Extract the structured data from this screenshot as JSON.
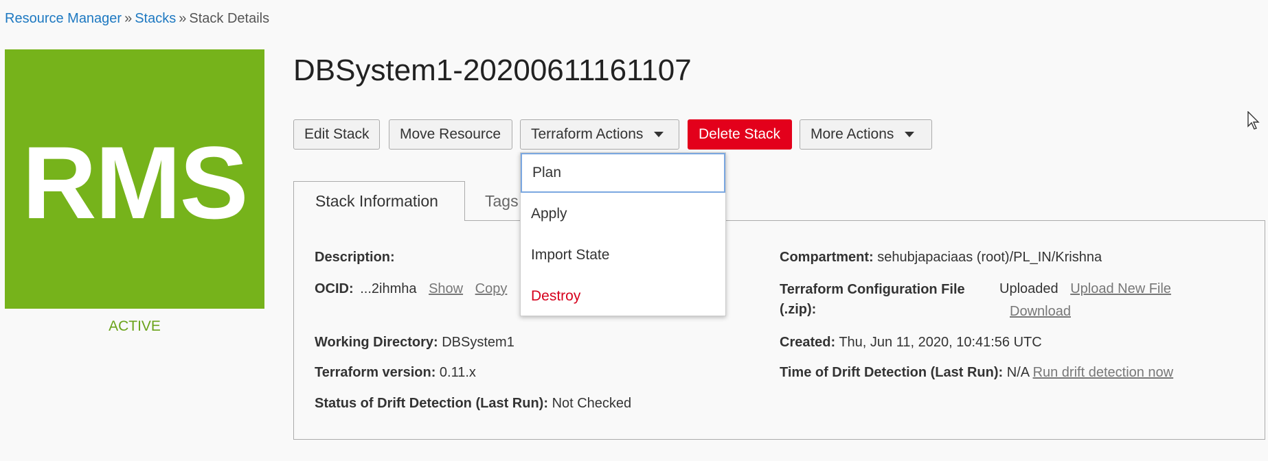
{
  "breadcrumb": {
    "items": [
      "Resource Manager",
      "Stacks",
      "Stack Details"
    ],
    "separator": "»"
  },
  "logo": {
    "text": "RMS",
    "color": "#76b31b"
  },
  "state": "ACTIVE",
  "title": "DBSystem1-20200611161107",
  "actions": {
    "edit": "Edit Stack",
    "move": "Move Resource",
    "terraform": "Terraform Actions",
    "delete": "Delete Stack",
    "more": "More Actions"
  },
  "terraform_menu": {
    "items": [
      "Plan",
      "Apply",
      "Import State",
      "Destroy"
    ],
    "focused": "Plan"
  },
  "tabs": [
    "Stack Information",
    "Tags"
  ],
  "active_tab": "Stack Information",
  "info": {
    "description_label": "Description:",
    "ocid_label": "OCID:",
    "ocid_value": "...2ihmha",
    "ocid_show": "Show",
    "ocid_copy": "Copy",
    "workdir_label": "Working Directory:",
    "workdir_value": "DBSystem1",
    "tfversion_label": "Terraform version:",
    "tfversion_value": "0.11.x",
    "drift_status_label": "Status of Drift Detection (Last Run):",
    "drift_status_value": "Not Checked",
    "compartment_label": "Compartment:",
    "compartment_value": "sehubjapaciaas (root)/PL_IN/Krishna",
    "config_label_line1": "Terraform Configuration File",
    "config_label_line2": "(.zip):",
    "config_value": "Uploaded",
    "config_upload": "Upload New File",
    "config_download": "Download",
    "created_label": "Created:",
    "created_value": "Thu, Jun 11, 2020, 10:41:56 UTC",
    "drift_time_label": "Time of Drift Detection (Last Run):",
    "drift_time_value": "N/A",
    "drift_run_link": "Run drift detection now"
  },
  "colors": {
    "link": "#1d78c1",
    "danger": "#e3001b",
    "active": "#6aa31a"
  }
}
